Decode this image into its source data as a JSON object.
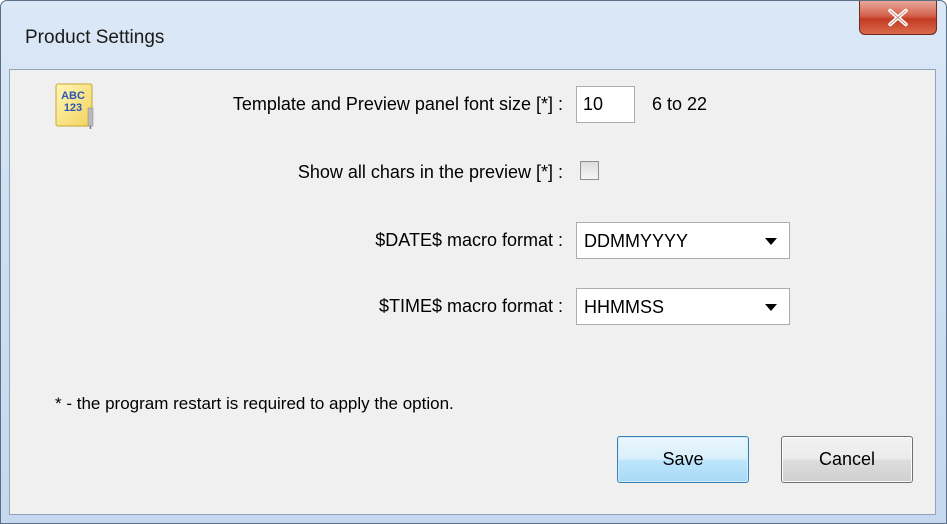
{
  "window": {
    "title": "Product Settings",
    "close_icon": "close-x-icon",
    "accent_close": "#c23b22"
  },
  "icon": {
    "name": "abc-123-icon",
    "line1": "ABC",
    "line2": "123"
  },
  "settings": {
    "font_size_label": "Template and Preview panel font size [*] :",
    "font_size_value": "10",
    "font_size_range": "6 to 22",
    "show_chars_label": "Show all chars in the preview [*] :",
    "show_chars_checked": false,
    "date_label": "$DATE$ macro format :",
    "date_value": "DDMMYYYY",
    "time_label": "$TIME$ macro format :",
    "time_value": "HHMMSS"
  },
  "footnote": "* - the program restart is required to apply the option.",
  "buttons": {
    "save": "Save",
    "cancel": "Cancel"
  }
}
